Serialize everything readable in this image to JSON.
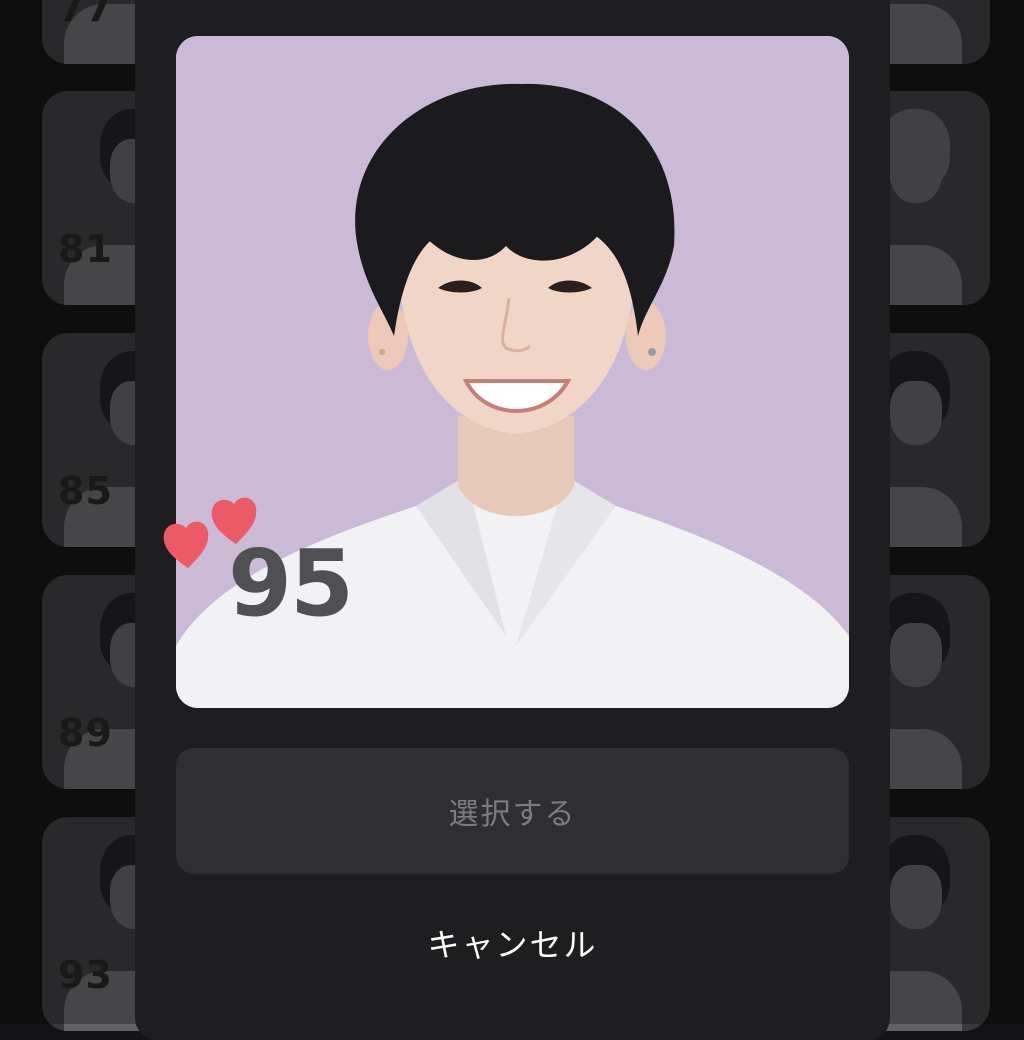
{
  "background_cards": {
    "left": [
      {
        "number": "77"
      },
      {
        "number": "81"
      },
      {
        "number": "85"
      },
      {
        "number": "89"
      },
      {
        "number": "93"
      }
    ],
    "right": [
      {
        "number": ""
      },
      {
        "number": ""
      },
      {
        "number": ""
      },
      {
        "number": ""
      },
      {
        "number": ""
      }
    ]
  },
  "modal": {
    "selected_number": "95",
    "select_label": "選択する",
    "cancel_label": "キャンセル"
  },
  "colors": {
    "photo_background": "#cbbad6",
    "heart": "#ec5a68",
    "button_bg": "#2f2f33"
  },
  "icons": [
    "hearts-icon"
  ]
}
